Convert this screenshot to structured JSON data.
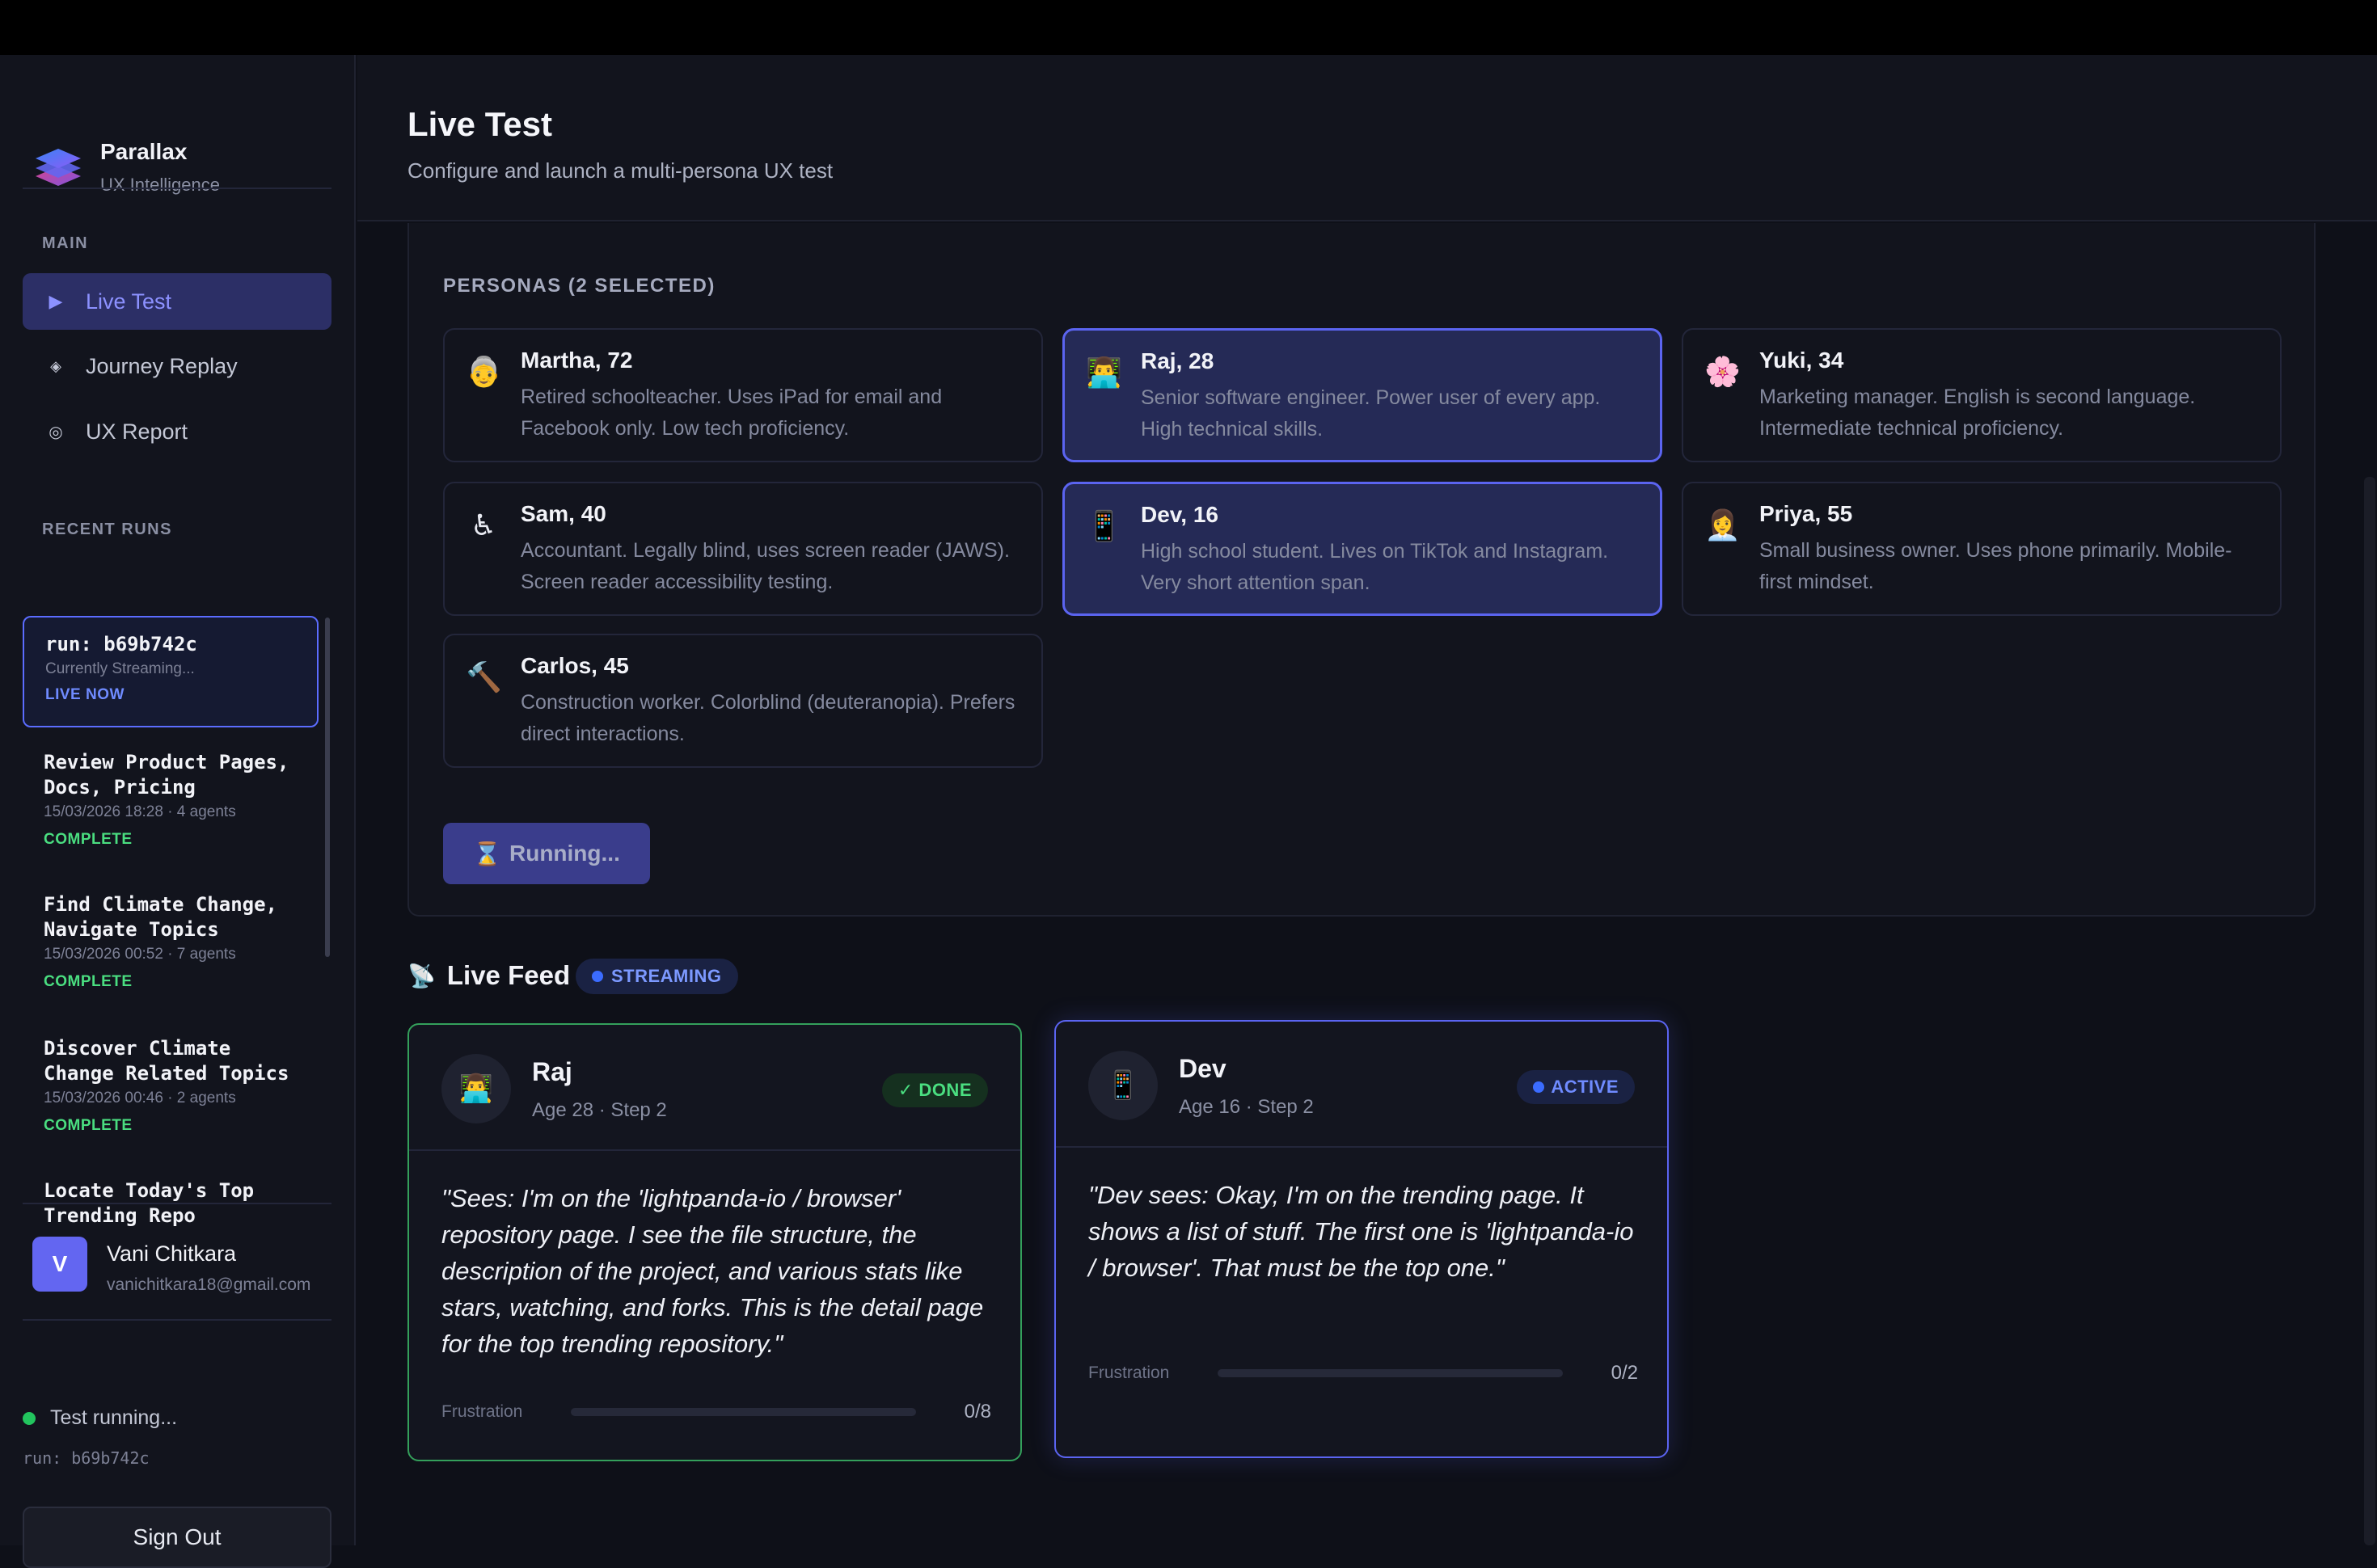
{
  "app": {
    "name": "Parallax",
    "tagline": "UX Intelligence"
  },
  "sidebar": {
    "main_label": "MAIN",
    "nav": [
      {
        "label": "Live Test",
        "icon": "play-icon",
        "active": true
      },
      {
        "label": "Journey Replay",
        "icon": "diamond-icon",
        "active": false
      },
      {
        "label": "UX Report",
        "icon": "circle-icon",
        "active": false
      }
    ],
    "recent_label": "RECENT RUNS",
    "runs": [
      {
        "title": "run: b69b742c",
        "meta": "Currently Streaming...",
        "status": "LIVE NOW"
      },
      {
        "title": "Review Product Pages, Docs, Pricing",
        "meta": "15/03/2026 18:28 · 4 agents",
        "status": "COMPLETE"
      },
      {
        "title": "Find Climate Change, Navigate Topics",
        "meta": "15/03/2026 00:52 · 7 agents",
        "status": "COMPLETE"
      },
      {
        "title": "Discover Climate Change Related Topics",
        "meta": "15/03/2026 00:46 · 2 agents",
        "status": "COMPLETE"
      },
      {
        "title": "Locate Today's Top Trending Repo",
        "meta": "",
        "status": ""
      }
    ],
    "user": {
      "initial": "V",
      "name": "Vani Chitkara",
      "email": "vanichitkara18@gmail.com"
    },
    "status_text": "Test running...",
    "status_run": "run: b69b742c",
    "signout_label": "Sign Out"
  },
  "header": {
    "title": "Live Test",
    "subtitle": "Configure and launch a multi-persona UX test"
  },
  "personas": {
    "label": "PERSONAS (2 SELECTED)",
    "items": [
      {
        "icon": "👵",
        "name": "Martha, 72",
        "desc": "Retired schoolteacher. Uses iPad for email and Facebook only. Low tech proficiency.",
        "selected": false
      },
      {
        "icon": "👨‍💻",
        "name": "Raj, 28",
        "desc": "Senior software engineer. Power user of every app. High technical skills.",
        "selected": true
      },
      {
        "icon": "🌸",
        "name": "Yuki, 34",
        "desc": "Marketing manager. English is second language. Intermediate technical proficiency.",
        "selected": false
      },
      {
        "icon": "♿",
        "name": "Sam, 40",
        "desc": "Accountant. Legally blind, uses screen reader (JAWS). Screen reader accessibility testing.",
        "selected": false
      },
      {
        "icon": "📱",
        "name": "Dev, 16",
        "desc": "High school student. Lives on TikTok and Instagram. Very short attention span.",
        "selected": true
      },
      {
        "icon": "👩‍💼",
        "name": "Priya, 55",
        "desc": "Small business owner. Uses phone primarily. Mobile-first mindset.",
        "selected": false
      },
      {
        "icon": "🔨",
        "name": "Carlos, 45",
        "desc": "Construction worker. Colorblind (deuteranopia). Prefers direct interactions.",
        "selected": false
      }
    ],
    "run_button": {
      "icon": "⌛",
      "label": "Running..."
    }
  },
  "feed": {
    "icon": "📡",
    "title": "Live Feed",
    "badge": "STREAMING",
    "cards": [
      {
        "avatar": "👨‍💻",
        "name": "Raj",
        "meta": "Age 28 · Step 2",
        "status": "✓ DONE",
        "quote": "\"Sees: I'm on the 'lightpanda-io / browser' repository page. I see the file structure, the description of the project, and various stats like stars, watching, and forks. This is the detail page for the top trending repository.\"",
        "frustration_label": "Frustration",
        "frustration_value": "0/8",
        "frustration_fraction": 0
      },
      {
        "avatar": "📱",
        "name": "Dev",
        "meta": "Age 16 · Step 2",
        "status": "ACTIVE",
        "quote": "\"Dev sees: Okay, I'm on the trending page. It shows a list of stuff. The first one is 'lightpanda-io / browser'. That must be the top one.\"",
        "frustration_label": "Frustration",
        "frustration_value": "0/2",
        "frustration_fraction": 0
      }
    ]
  },
  "colors": {
    "accent": "#5b64f0",
    "success": "#4ade80",
    "live": "#6f8bff",
    "background": "#0e1018"
  }
}
